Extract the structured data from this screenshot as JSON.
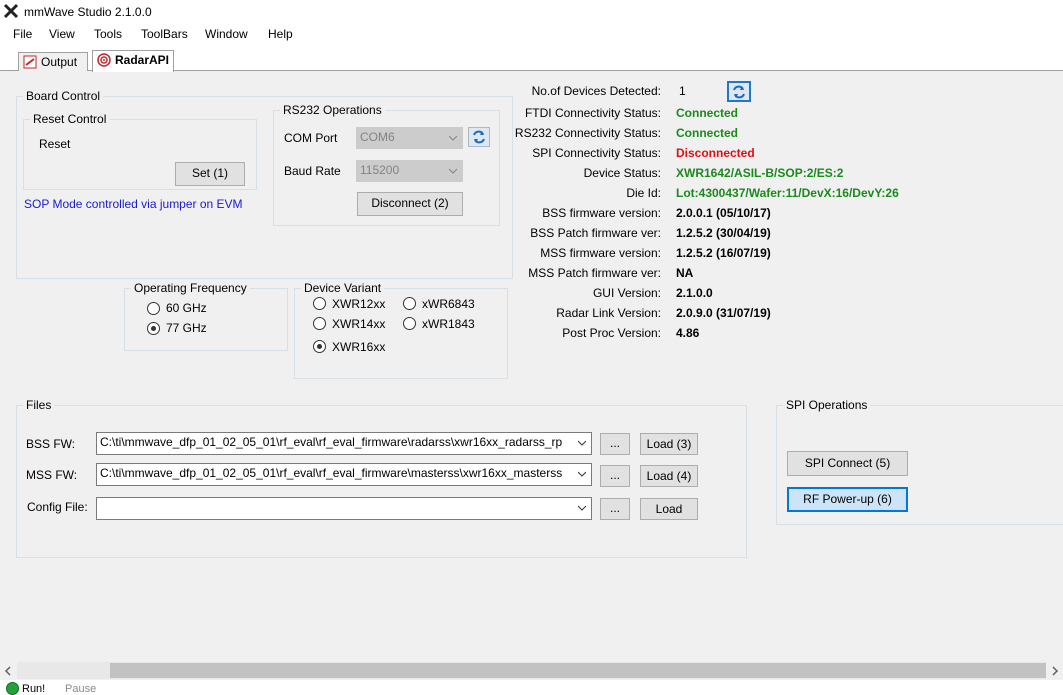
{
  "window": {
    "title": "mmWave Studio 2.1.0.0"
  },
  "menu": [
    "File",
    "View",
    "Tools",
    "ToolBars",
    "Window",
    "Help"
  ],
  "tabs": [
    {
      "label": "Output"
    },
    {
      "label": "RadarAPI",
      "active": true
    }
  ],
  "board_control": {
    "title": "Board Control",
    "reset_control": {
      "title": "Reset Control",
      "label": "Reset",
      "button": "Set (1)"
    },
    "sop_note": "SOP Mode controlled via jumper on EVM",
    "rs232": {
      "title": "RS232 Operations",
      "com_port_label": "COM Port",
      "com_port_value": "COM6",
      "baud_rate_label": "Baud Rate",
      "baud_rate_value": "115200",
      "disconnect_button": "Disconnect (2)"
    }
  },
  "operating_frequency": {
    "title": "Operating Frequency",
    "options": [
      "60 GHz",
      "77 GHz"
    ],
    "selected": "77 GHz"
  },
  "device_variant": {
    "title": "Device Variant",
    "options": [
      "XWR12xx",
      "xWR6843",
      "XWR14xx",
      "xWR1843",
      "XWR16xx"
    ],
    "selected": "XWR16xx"
  },
  "status_info": {
    "rows": [
      {
        "label": "No.of Devices Detected:",
        "value": "1",
        "color": "#000000"
      },
      {
        "label": "FTDI Connectivity Status:",
        "value": "Connected",
        "color": "#1a8a1a"
      },
      {
        "label": "RS232 Connectivity Status:",
        "value": "Connected",
        "color": "#1a8a1a"
      },
      {
        "label": "SPI Connectivity Status:",
        "value": "Disconnected",
        "color": "#e01010"
      },
      {
        "label": "Device Status:",
        "value": "XWR1642/ASIL-B/SOP:2/ES:2",
        "color": "#1a8a1a"
      },
      {
        "label": "Die Id:",
        "value": "Lot:4300437/Wafer:11/DevX:16/DevY:26",
        "color": "#1a8a1a"
      },
      {
        "label": "BSS firmware version:",
        "value": "2.0.0.1 (05/10/17)",
        "color": "#000000"
      },
      {
        "label": "BSS Patch firmware ver:",
        "value": "1.2.5.2 (30/04/19)",
        "color": "#000000"
      },
      {
        "label": "MSS firmware version:",
        "value": "1.2.5.2 (16/07/19)",
        "color": "#000000"
      },
      {
        "label": "MSS Patch firmware ver:",
        "value": "NA",
        "color": "#000000"
      },
      {
        "label": "GUI Version:",
        "value": "2.1.0.0",
        "color": "#000000"
      },
      {
        "label": "Radar Link Version:",
        "value": "2.0.9.0 (31/07/19)",
        "color": "#000000"
      },
      {
        "label": "Post Proc Version:",
        "value": "4.86",
        "color": "#000000"
      }
    ]
  },
  "files": {
    "title": "Files",
    "bss": {
      "label": "BSS FW:",
      "value": "C:\\ti\\mmwave_dfp_01_02_05_01\\rf_eval\\rf_eval_firmware\\radarss\\xwr16xx_radarss_rp",
      "browse": "...",
      "load": "Load (3)"
    },
    "mss": {
      "label": "MSS FW:",
      "value": "C:\\ti\\mmwave_dfp_01_02_05_01\\rf_eval\\rf_eval_firmware\\masterss\\xwr16xx_masterss",
      "browse": "...",
      "load": "Load (4)"
    },
    "config": {
      "label": "Config File:",
      "value": "",
      "browse": "...",
      "load": "Load"
    }
  },
  "spi_operations": {
    "title": "SPI Operations",
    "connect_button": "SPI Connect (5)",
    "rf_powerup_button": "RF Power-up (6)"
  },
  "statusbar": {
    "run": "Run!",
    "pause": "Pause"
  }
}
